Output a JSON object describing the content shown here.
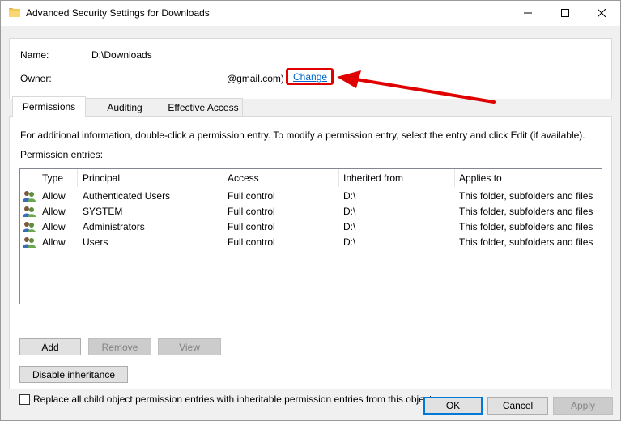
{
  "window": {
    "title": "Advanced Security Settings for Downloads",
    "controls": {
      "minimize": "minimize",
      "maximize": "maximize",
      "close": "close"
    }
  },
  "object": {
    "name_label": "Name:",
    "name_value": "D:\\Downloads",
    "owner_label": "Owner:",
    "owner_value": "@gmail.com)",
    "owner_change": "Change"
  },
  "tabs": [
    {
      "label": "Permissions",
      "active": true
    },
    {
      "label": "Auditing",
      "active": false
    },
    {
      "label": "Effective Access",
      "active": false
    }
  ],
  "permissions": {
    "info_text": "For additional information, double-click a permission entry. To modify a permission entry, select the entry and click Edit (if available).",
    "entries_label": "Permission entries:",
    "columns": [
      "Type",
      "Principal",
      "Access",
      "Inherited from",
      "Applies to"
    ],
    "rows": [
      {
        "type": "Allow",
        "principal": "Authenticated Users",
        "access": "Full control",
        "inherited": "D:\\",
        "applies": "This folder, subfolders and files"
      },
      {
        "type": "Allow",
        "principal": "SYSTEM",
        "access": "Full control",
        "inherited": "D:\\",
        "applies": "This folder, subfolders and files"
      },
      {
        "type": "Allow",
        "principal": "Administrators",
        "access": "Full control",
        "inherited": "D:\\",
        "applies": "This folder, subfolders and files"
      },
      {
        "type": "Allow",
        "principal": "Users",
        "access": "Full control",
        "inherited": "D:\\",
        "applies": "This folder, subfolders and files"
      }
    ],
    "add_label": "Add",
    "remove_label": "Remove",
    "view_label": "View",
    "disable_inheritance_label": "Disable inheritance",
    "replace_checkbox_label": "Replace all child object permission entries with inheritable permission entries from this object"
  },
  "footer": {
    "ok_label": "OK",
    "cancel_label": "Cancel",
    "apply_label": "Apply"
  },
  "colors": {
    "annotation": "#e00000",
    "link": "#0066cc",
    "accent": "#0078d7"
  },
  "icons": {
    "title": "folder-icon",
    "principal": "users-icon"
  }
}
